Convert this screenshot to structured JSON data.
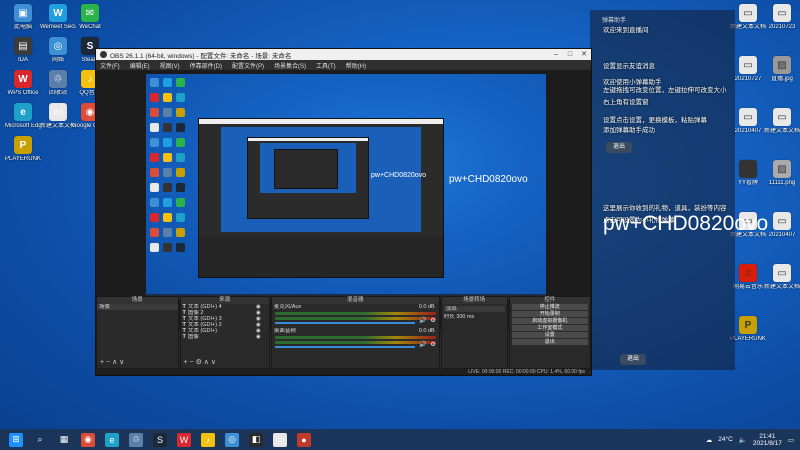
{
  "desktop": {
    "left_icons": [
      {
        "label": "此电脑",
        "color": "#3d8fd6",
        "glyph": "▣"
      },
      {
        "label": "Wemeet Security",
        "color": "#1f9fe0",
        "glyph": "W"
      },
      {
        "label": "WeChat",
        "color": "#2ab34b",
        "glyph": "✉"
      },
      {
        "label": "IDA",
        "color": "#3c3c3c",
        "glyph": "▤"
      },
      {
        "label": "网络",
        "color": "#3d8fd6",
        "glyph": "◎"
      },
      {
        "label": "Steam",
        "color": "#1b2838",
        "glyph": "S"
      },
      {
        "label": "WPS Office",
        "color": "#d9272e",
        "glyph": "W"
      },
      {
        "label": "回收站",
        "color": "#5a7fa8",
        "glyph": "♲"
      },
      {
        "label": "QQ音乐",
        "color": "#f4c20d",
        "glyph": "♪"
      },
      {
        "label": "Microsoft Edge",
        "color": "#1da1c6",
        "glyph": "e"
      },
      {
        "label": "新建文本文档",
        "color": "#e8e8e8",
        "glyph": "▭"
      },
      {
        "label": "Google Chrome",
        "color": "#dd4b39",
        "glyph": "◉"
      },
      {
        "label": "PLAYERUNKNOWN'S BATTLEGROUNDS",
        "color": "#c8a000",
        "glyph": "P"
      }
    ],
    "right_icons": [
      {
        "label": "新建文本文档 (3).txt",
        "color": "#e8e8e8",
        "glyph": "▭"
      },
      {
        "label": "20210723",
        "color": "#e8e8e8",
        "glyph": "▭"
      },
      {
        "label": "20210727",
        "color": "#e8e8e8",
        "glyph": "▭"
      },
      {
        "label": "直播.jpg",
        "color": "#999",
        "glyph": "▨"
      },
      {
        "label": "20210407",
        "color": "#e8e8e8",
        "glyph": "▭"
      },
      {
        "label": "新建文本文档 (2).txt",
        "color": "#e8e8e8",
        "glyph": "▭"
      },
      {
        "label": "YY看牌",
        "color": "#333",
        "glyph": "Y"
      },
      {
        "label": "11111.png",
        "color": "#aaa",
        "glyph": "▨"
      },
      {
        "label": "新建文本文档 (5).txt",
        "color": "#e8e8e8",
        "glyph": "▭"
      },
      {
        "label": "20210407",
        "color": "#e8e8e8",
        "glyph": "▭"
      },
      {
        "label": "网易云音乐",
        "color": "#d81e06",
        "glyph": "♫"
      },
      {
        "label": "新建文本文档 (4).txt",
        "color": "#e8e8e8",
        "glyph": "▭"
      },
      {
        "label": "PLAYERUNKNOWN'S BATTLEGROUNDS",
        "color": "#c8a000",
        "glyph": "P"
      }
    ]
  },
  "obs": {
    "title": "OBS 26.1.1 (64-bit, windows) - 配置文件: 未命名 - 场景: 未命名",
    "menu": [
      "文件(F)",
      "编辑(E)",
      "视图(V)",
      "停靠部件(D)",
      "配置文件(P)",
      "场景集合(S)",
      "工具(T)",
      "帮助(H)"
    ],
    "preview_text": "pw+CHD0820ovo",
    "dock_titles": [
      "场景",
      "来源",
      "混音器",
      "场景转场",
      "控件"
    ],
    "scene_item": "场景",
    "sources": [
      "文本 (GDI+) 4",
      "图像 2",
      "文本 (GDI+) 3",
      "文本 (GDI+) 2",
      "文本 (GDI+)",
      "图像"
    ],
    "mixer": [
      {
        "name": "麦克风/Aux",
        "db": "0.0 dB"
      },
      {
        "name": "桌面音频",
        "db": "0.0 dB"
      }
    ],
    "transition": {
      "type": "淡出",
      "duration_label": "时长",
      "duration": "300 ms"
    },
    "controls": [
      "停止推流",
      "开始录制",
      "启动虚拟摄像机",
      "工作室模式",
      "设置",
      "退出"
    ],
    "statusbar": "LIVE: 00:00:00   REC: 00:00:00   CPU: 1.4%, 60.00 fps"
  },
  "overlay": {
    "header": "弹幕助手",
    "lines": [
      "欢迎来到直播间",
      "设置显示友谊消息",
      "欢迎使用小弹幕助手",
      "左键拖拽可改变位置，左键拉伸可改变大小",
      "右上角有设置窗",
      "设置点击设置，更换模板，粘贴弹幕",
      "添加弹幕助手成功",
      "这里展示你收到的礼物，道具，装扮等内容",
      "点击可设置为小礼物弹幕"
    ],
    "exit_label": "退出",
    "big_text": "pw+CHD0820ovo"
  },
  "taskbar": {
    "apps": [
      "⊞",
      "⌕",
      "▦",
      "◉",
      "e",
      "♲",
      "S",
      "W",
      "♪",
      "◎",
      "◧",
      "▭",
      "●"
    ],
    "weather": "24°C",
    "time": "21:41",
    "date": "2021/8/17"
  }
}
